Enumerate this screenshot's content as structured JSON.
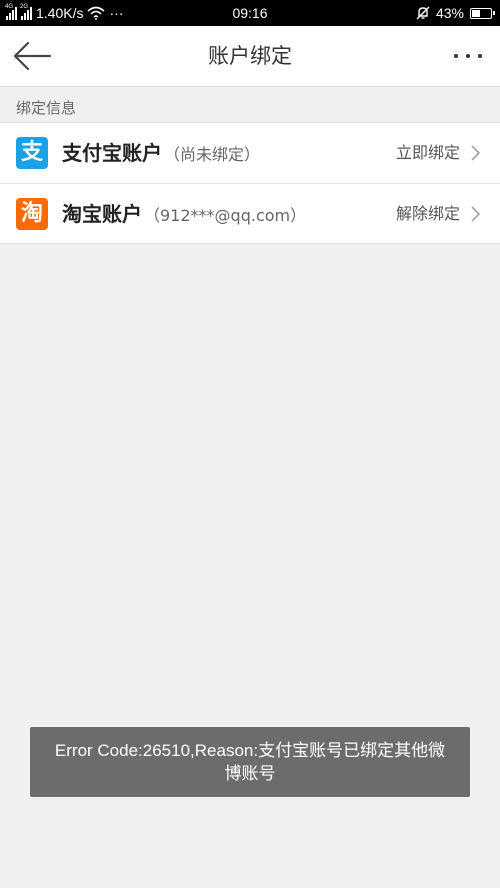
{
  "status_bar": {
    "network_speed": "1.40K/s",
    "dots": "···",
    "time": "09:16",
    "battery_level": "43%",
    "sig1_label": "4G",
    "sig2_label": "2G"
  },
  "navbar": {
    "title": "账户绑定"
  },
  "section": {
    "label": "绑定信息"
  },
  "accounts": [
    {
      "icon_char": "支",
      "icon_color": "#1aa1e6",
      "name": "支付宝账户",
      "detail": "（尚未绑定）",
      "action": "立即绑定"
    },
    {
      "icon_char": "淘",
      "icon_color": "#ff6a00",
      "name": "淘宝账户",
      "detail": "（912***@qq.com）",
      "action": "解除绑定"
    }
  ],
  "toast": {
    "message": "Error Code:26510,Reason:支付宝账号已绑定其他微博账号"
  },
  "colors": {
    "background": "#f0f0f0",
    "toast_bg": "#6c6c6c"
  }
}
